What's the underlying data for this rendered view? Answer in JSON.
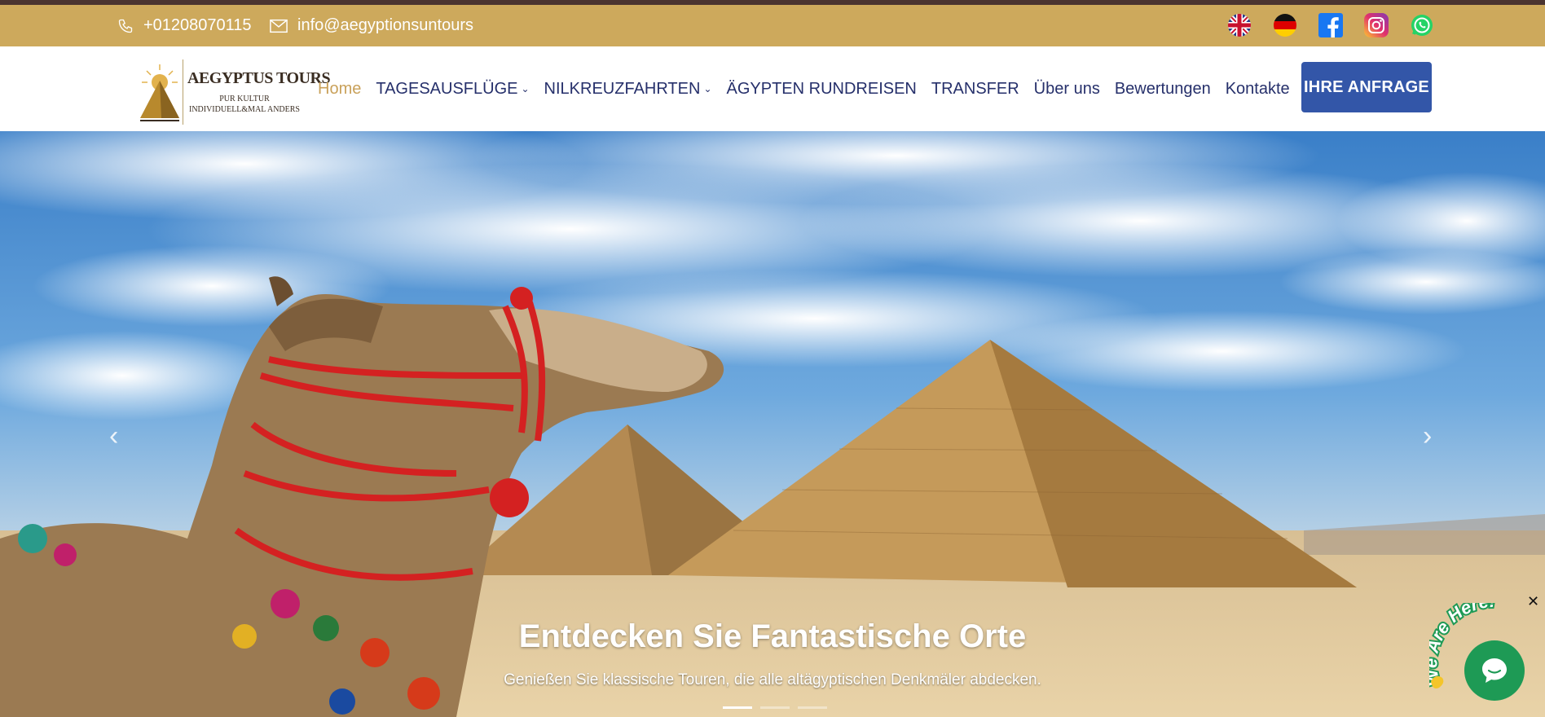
{
  "topbar": {
    "phone": "+01208070115",
    "email": "info@aegyptionsuntours",
    "socials": [
      "uk-flag-icon",
      "germany-flag-icon",
      "facebook-icon",
      "instagram-icon",
      "whatsapp-icon"
    ]
  },
  "logo": {
    "title": "AEGYPTUS TOURS",
    "tagline1": "PUR KULTUR",
    "tagline2": "INDIVIDUELL&MAL ANDERS"
  },
  "nav": {
    "items": [
      {
        "label": "Home",
        "active": true
      },
      {
        "label": "TAGESAUSFLÜGE",
        "dropdown": true
      },
      {
        "label": "NILKREUZFAHRTEN",
        "dropdown": true
      },
      {
        "label": "ÄGYPTEN RUNDREISEN"
      },
      {
        "label": "TRANSFER"
      },
      {
        "label": "Über uns"
      },
      {
        "label": "Bewertungen"
      },
      {
        "label": "Kontakte"
      }
    ],
    "cta": "IHRE ANFRAGE"
  },
  "hero": {
    "title": "Entdecken Sie Fantastische Orte",
    "subtitle": "Genießen Sie klassische Touren, die alle altägyptischen Denkmäler abdecken.",
    "slides": 3,
    "active_slide": 1
  },
  "chat": {
    "tag": "We Are Here!",
    "close": "✕"
  },
  "colors": {
    "topbar": "#cda95c",
    "brand_navy": "#26306b",
    "active": "#c9a15a",
    "cta": "#3356a8",
    "chat": "#1e9a55"
  }
}
